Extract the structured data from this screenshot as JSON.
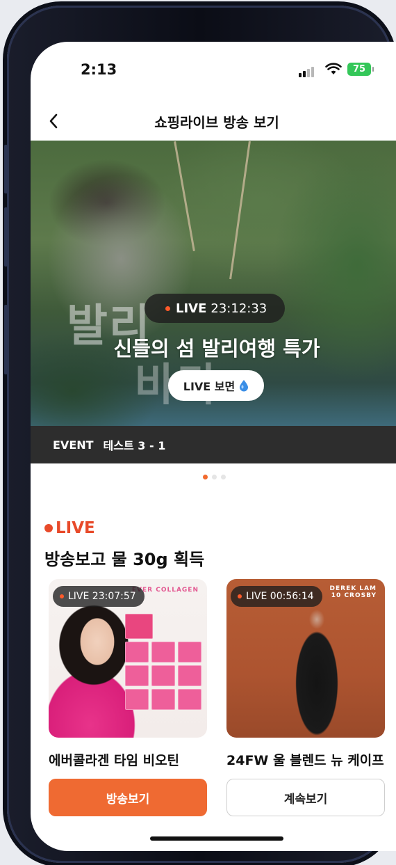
{
  "status_bar": {
    "time": "2:13",
    "battery": "75"
  },
  "nav": {
    "title": "쇼핑라이브 방송 보기"
  },
  "hero": {
    "live_label": "LIVE",
    "countdown": "23:12:33",
    "title": "신들의 섬 발리여행 특가",
    "watch_label": "LIVE 보면",
    "bg_text_1": "발리",
    "bg_text_2": "바다",
    "event_tag": "EVENT",
    "event_name": "테스트 3 - 1"
  },
  "carousel": {
    "total": 3,
    "active": 0
  },
  "live_section": {
    "heading": "LIVE",
    "subtitle": "방송보고 물 30g 획득",
    "cards": [
      {
        "live_label": "LIVE 23:07:57",
        "name": "에버콜라겐 타임 비오틴",
        "button": "방송보기",
        "style": "primary",
        "brand": "EVER COLLAGEN"
      },
      {
        "live_label": "LIVE 00:56:14",
        "name": "24FW 울 블렌드 뉴 케이프",
        "button": "계속보기",
        "style": "outline",
        "brand": "DEREK LAM 10 CROSBY"
      }
    ]
  },
  "colors": {
    "accent": "#ef6a32",
    "live_red": "#e84a2a",
    "battery": "#34c759"
  },
  "icons": [
    "back-icon",
    "signal-icon",
    "wifi-icon",
    "battery-icon",
    "water-drop-icon"
  ]
}
